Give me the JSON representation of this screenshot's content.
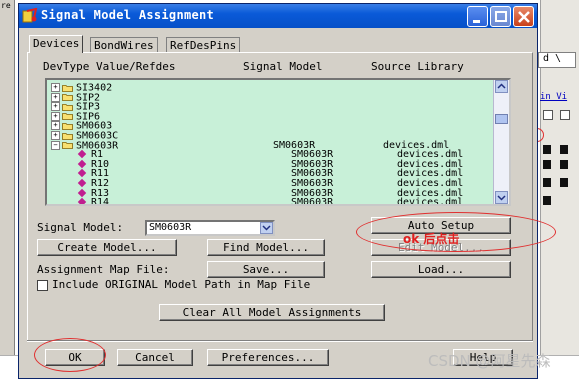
{
  "window": {
    "title": "Signal Model Assignment",
    "controls": [
      "minimize-icon",
      "maximize-icon",
      "close-icon"
    ]
  },
  "tabs": [
    {
      "label": "Devices",
      "active": true
    },
    {
      "label": "BondWires",
      "active": false
    },
    {
      "label": "RefDesPins",
      "active": false
    }
  ],
  "table": {
    "headers": [
      "DevType Value/Refdes",
      "Signal Model",
      "Source Library"
    ],
    "rows": [
      {
        "name": "SI3402",
        "type": "folder",
        "expanded": false,
        "model": "",
        "library": ""
      },
      {
        "name": "SIP2",
        "type": "folder",
        "expanded": false,
        "model": "",
        "library": ""
      },
      {
        "name": "SIP3",
        "type": "folder",
        "expanded": false,
        "model": "",
        "library": ""
      },
      {
        "name": "SIP6",
        "type": "folder",
        "expanded": false,
        "model": "",
        "library": ""
      },
      {
        "name": "SM0603",
        "type": "folder",
        "expanded": false,
        "model": "",
        "library": ""
      },
      {
        "name": "SM0603C",
        "type": "folder",
        "expanded": false,
        "model": "",
        "library": ""
      },
      {
        "name": "SM0603R",
        "type": "folder",
        "expanded": true,
        "model": "SM0603R",
        "library": "devices.dml"
      },
      {
        "name": "R1",
        "type": "part",
        "model": "SM0603R",
        "library": "devices.dml"
      },
      {
        "name": "R10",
        "type": "part",
        "model": "SM0603R",
        "library": "devices.dml"
      },
      {
        "name": "R11",
        "type": "part",
        "model": "SM0603R",
        "library": "devices.dml"
      },
      {
        "name": "R12",
        "type": "part",
        "model": "SM0603R",
        "library": "devices.dml"
      },
      {
        "name": "R13",
        "type": "part",
        "model": "SM0603R",
        "library": "devices.dml"
      },
      {
        "name": "R14",
        "type": "part",
        "model": "SM0603R",
        "library": "devices.dml"
      }
    ]
  },
  "signal_model": {
    "label": "Signal Model:",
    "value": "SM0603R"
  },
  "buttons": {
    "auto_setup": "Auto Setup",
    "create_model": "Create Model...",
    "find_model": "Find Model...",
    "edit_model": "Edit Model...",
    "save": "Save...",
    "load": "Load...",
    "clear_all": "Clear All Model Assignments",
    "ok": "OK",
    "cancel": "Cancel",
    "preferences": "Preferences...",
    "help": "Help"
  },
  "map_file": {
    "label": "Assignment Map File:",
    "include_label": "Include ORIGINAL Model Path in Map File",
    "include_checked": false
  },
  "annotations": {
    "note": "ok 后点击"
  },
  "background": {
    "tab_text": "d \\",
    "link_text": "in Vi",
    "corner_text": "re"
  },
  "watermark": "CSDN @阿星先森",
  "colors": {
    "tree_bg": "#c8f0d8",
    "titlebar": "#0a5ad8",
    "annotation": "#e03030"
  }
}
